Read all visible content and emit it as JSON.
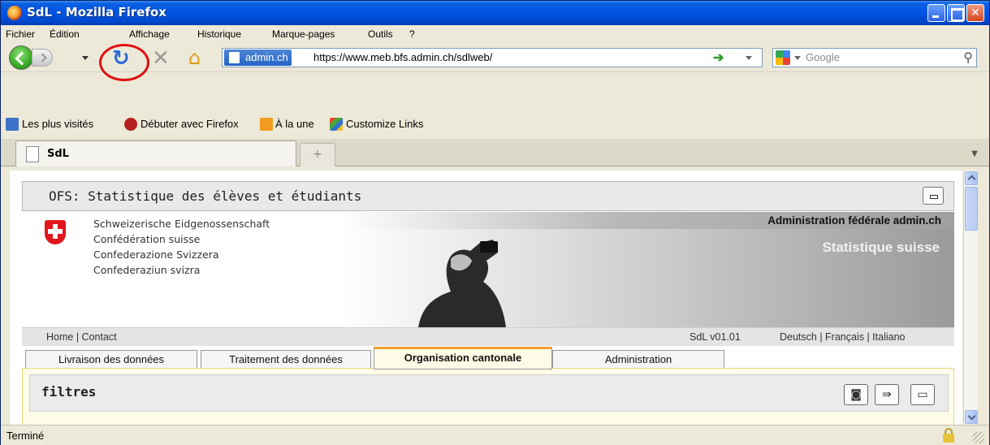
{
  "window": {
    "title": "SdL - Mozilla Firefox"
  },
  "menu": {
    "items": [
      "Fichier",
      "Édition",
      "Affichage",
      "Historique",
      "Marque-pages",
      "Outils",
      "?"
    ]
  },
  "navigation": {
    "site_identity": "admin.ch",
    "url": "https://www.meb.bfs.admin.ch/sdlweb/",
    "search_placeholder": "Google",
    "reload_highlight_color": "#e01010"
  },
  "bookmarks": {
    "items": [
      "Les plus visités",
      "Débuter avec Firefox",
      "À la une",
      "Customize Links"
    ]
  },
  "tabs": {
    "active_label": "SdL",
    "new_tab_glyph": "+"
  },
  "page": {
    "panel_title": "OFS: Statistique des élèves et étudiants",
    "confederation": [
      "Schweizerische Eidgenossenschaft",
      "Confédération suisse",
      "Confederazione Svizzera",
      "Confederaziun svizra"
    ],
    "admin_title": "Administration fédérale admin.ch",
    "stat_suisse": "Statistique suisse",
    "links": {
      "home_contact": "Home | Contact",
      "version": "SdL v01.01",
      "languages": "Deutsch | Français | Italiano"
    },
    "app_tabs": [
      "Livraison des données",
      "Traitement des données",
      "Organisation cantonale",
      "Administration"
    ],
    "active_app_tab": "Organisation cantonale",
    "filters_title": "filtres"
  },
  "status": {
    "text": "Terminé"
  },
  "colors": {
    "titlebar_blue": "#0054e3",
    "swiss_red": "#e2161e",
    "active_tab_accent": "#f0a030"
  }
}
